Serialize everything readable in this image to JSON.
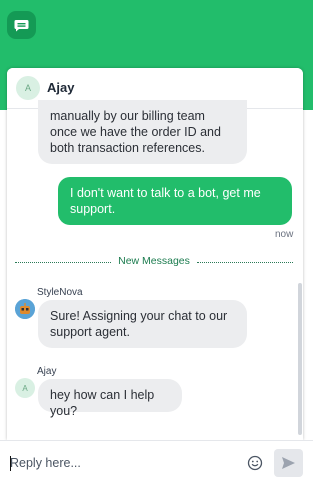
{
  "header": {
    "logo_icon": "chat-bubble-icon",
    "color": "#22bd6b"
  },
  "conversation": {
    "agent_name": "Ajay",
    "agent_initial": "A"
  },
  "messages": [
    {
      "type": "incoming",
      "text": "manually by our billing team once we have the order ID and both transaction references."
    },
    {
      "type": "outgoing",
      "text": "I don't want to talk to a bot, get me support.",
      "time": "now"
    },
    {
      "type": "incoming",
      "sender": "StyleNova",
      "text": "Sure! Assigning your chat to our support agent."
    },
    {
      "type": "incoming",
      "sender": "Ajay",
      "initial": "A",
      "text": "hey how can I help you?"
    }
  ],
  "divider": {
    "label": "New Messages"
  },
  "composer": {
    "placeholder": "Reply here...",
    "emoji_icon": "smiley-icon",
    "send_icon": "send-icon"
  }
}
